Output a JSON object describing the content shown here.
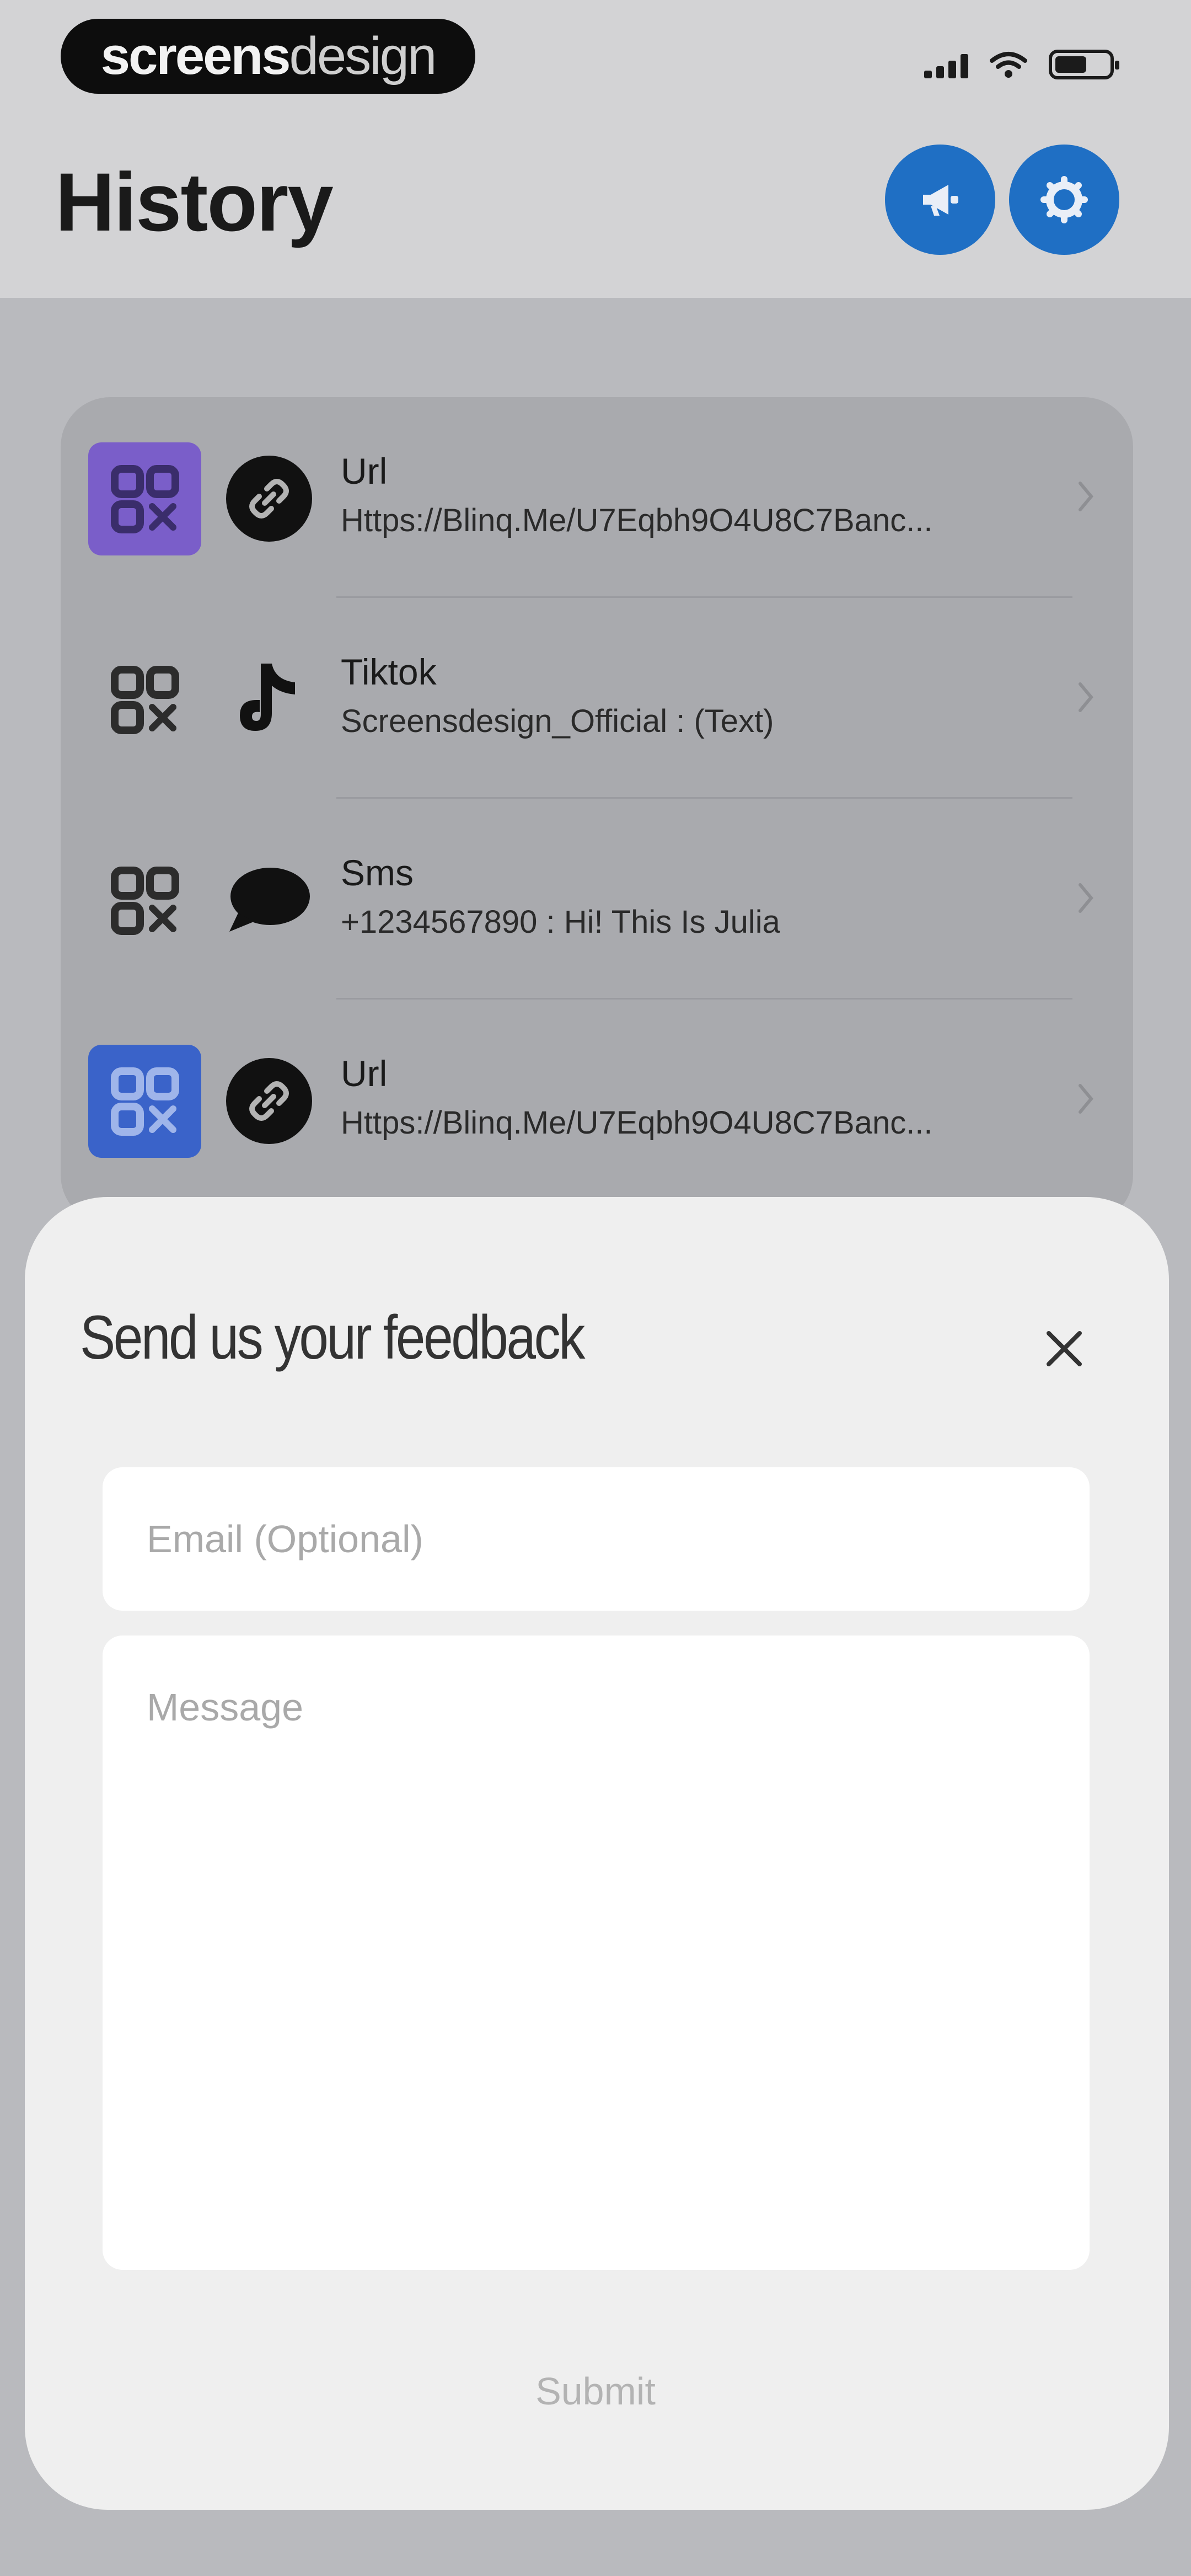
{
  "brand": {
    "logo_bold": "screens",
    "logo_light": "design"
  },
  "header": {
    "title": "History",
    "announce_icon": "megaphone-icon",
    "settings_icon": "gear-icon"
  },
  "history": {
    "items": [
      {
        "type_icon": "link-icon",
        "qr_color": "#7a5ec9",
        "title": "Url",
        "subtitle": "Https://Blinq.Me/U7Eqbh9O4U8C7Banc..."
      },
      {
        "type_icon": "tiktok-icon",
        "qr_color": "",
        "title": "Tiktok",
        "subtitle": "Screensdesign_Official : (Text)"
      },
      {
        "type_icon": "chat-bubble-icon",
        "qr_color": "",
        "title": "Sms",
        "subtitle": "+1234567890 : Hi! This Is Julia"
      },
      {
        "type_icon": "link-icon",
        "qr_color": "#3a63c9",
        "title": "Url",
        "subtitle": "Https://Blinq.Me/U7Eqbh9O4U8C7Banc..."
      }
    ]
  },
  "feedback": {
    "title": "Send us your feedback",
    "email_placeholder": "Email (Optional)",
    "email_value": "",
    "message_placeholder": "Message",
    "message_value": "",
    "submit_label": "Submit"
  },
  "colors": {
    "accent": "#1f6fc4",
    "sheet_bg": "#efefef"
  }
}
